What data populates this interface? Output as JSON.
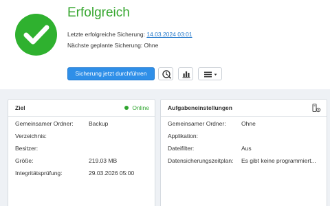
{
  "status": {
    "title": "Erfolgreich",
    "icon": "checkmark-icon",
    "color": "#2fb12f",
    "last_backup_label": "Letzte erfolgreiche Sicherung:",
    "last_backup_value": "14.03.2024 03:01",
    "next_backup_label": "Nächste geplante Sicherung:",
    "next_backup_value": "Ohne"
  },
  "toolbar": {
    "backup_now_label": "Sicherung jetzt durchführen",
    "history_icon": "history-icon",
    "stats_icon": "bar-chart-icon",
    "menu_icon": "menu-icon"
  },
  "target": {
    "title": "Ziel",
    "state": "Online",
    "rows": [
      {
        "label": "Gemeinsamer Ordner:",
        "value": "Backup"
      },
      {
        "label": "Verzeichnis:",
        "value": ""
      },
      {
        "label": "Besitzer:",
        "value": ""
      },
      {
        "label": "Größe:",
        "value": "219.03 MB"
      },
      {
        "label": "Integritätsprüfung:",
        "value": "29.03.2026 05:00"
      }
    ]
  },
  "task_settings": {
    "title": "Aufgabeneinstellungen",
    "settings_icon": "task-settings-icon",
    "rows": [
      {
        "label": "Gemeinsamer Ordner:",
        "value": "Ohne"
      },
      {
        "label": "Applikation:",
        "value": ""
      },
      {
        "label": "Dateifilter:",
        "value": "Aus"
      },
      {
        "label": "Datensicherungszeitplan:",
        "value": "Es gibt keine programmiert..."
      }
    ]
  }
}
